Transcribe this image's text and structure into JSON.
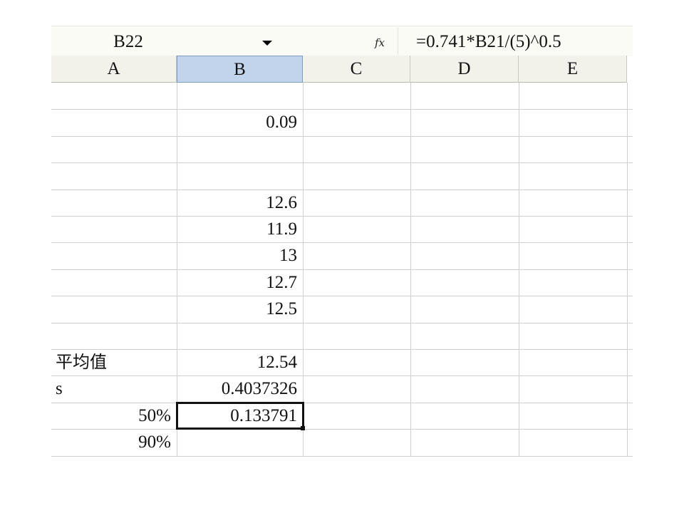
{
  "formula_bar": {
    "name_box": "B22",
    "fx_label": "fx",
    "formula": "=0.741*B21/(5)^0.5"
  },
  "columns": [
    "A",
    "B",
    "C",
    "D",
    "E"
  ],
  "selected_column": "B",
  "rows": [
    {
      "a": "",
      "b": ""
    },
    {
      "a": "",
      "b": "0.09"
    },
    {
      "a": "",
      "b": ""
    },
    {
      "a": "",
      "b": ""
    },
    {
      "a": "",
      "b": "12.6"
    },
    {
      "a": "",
      "b": "11.9"
    },
    {
      "a": "",
      "b": "13"
    },
    {
      "a": "",
      "b": "12.7"
    },
    {
      "a": "",
      "b": "12.5"
    },
    {
      "a": "",
      "b": ""
    },
    {
      "a": "平均值",
      "b": "12.54"
    },
    {
      "a": "s",
      "b": "0.4037326"
    },
    {
      "a": "50%",
      "b": "0.133791"
    },
    {
      "a": "90%",
      "b": ""
    }
  ],
  "active_cell": {
    "row": 12,
    "col": "B"
  }
}
